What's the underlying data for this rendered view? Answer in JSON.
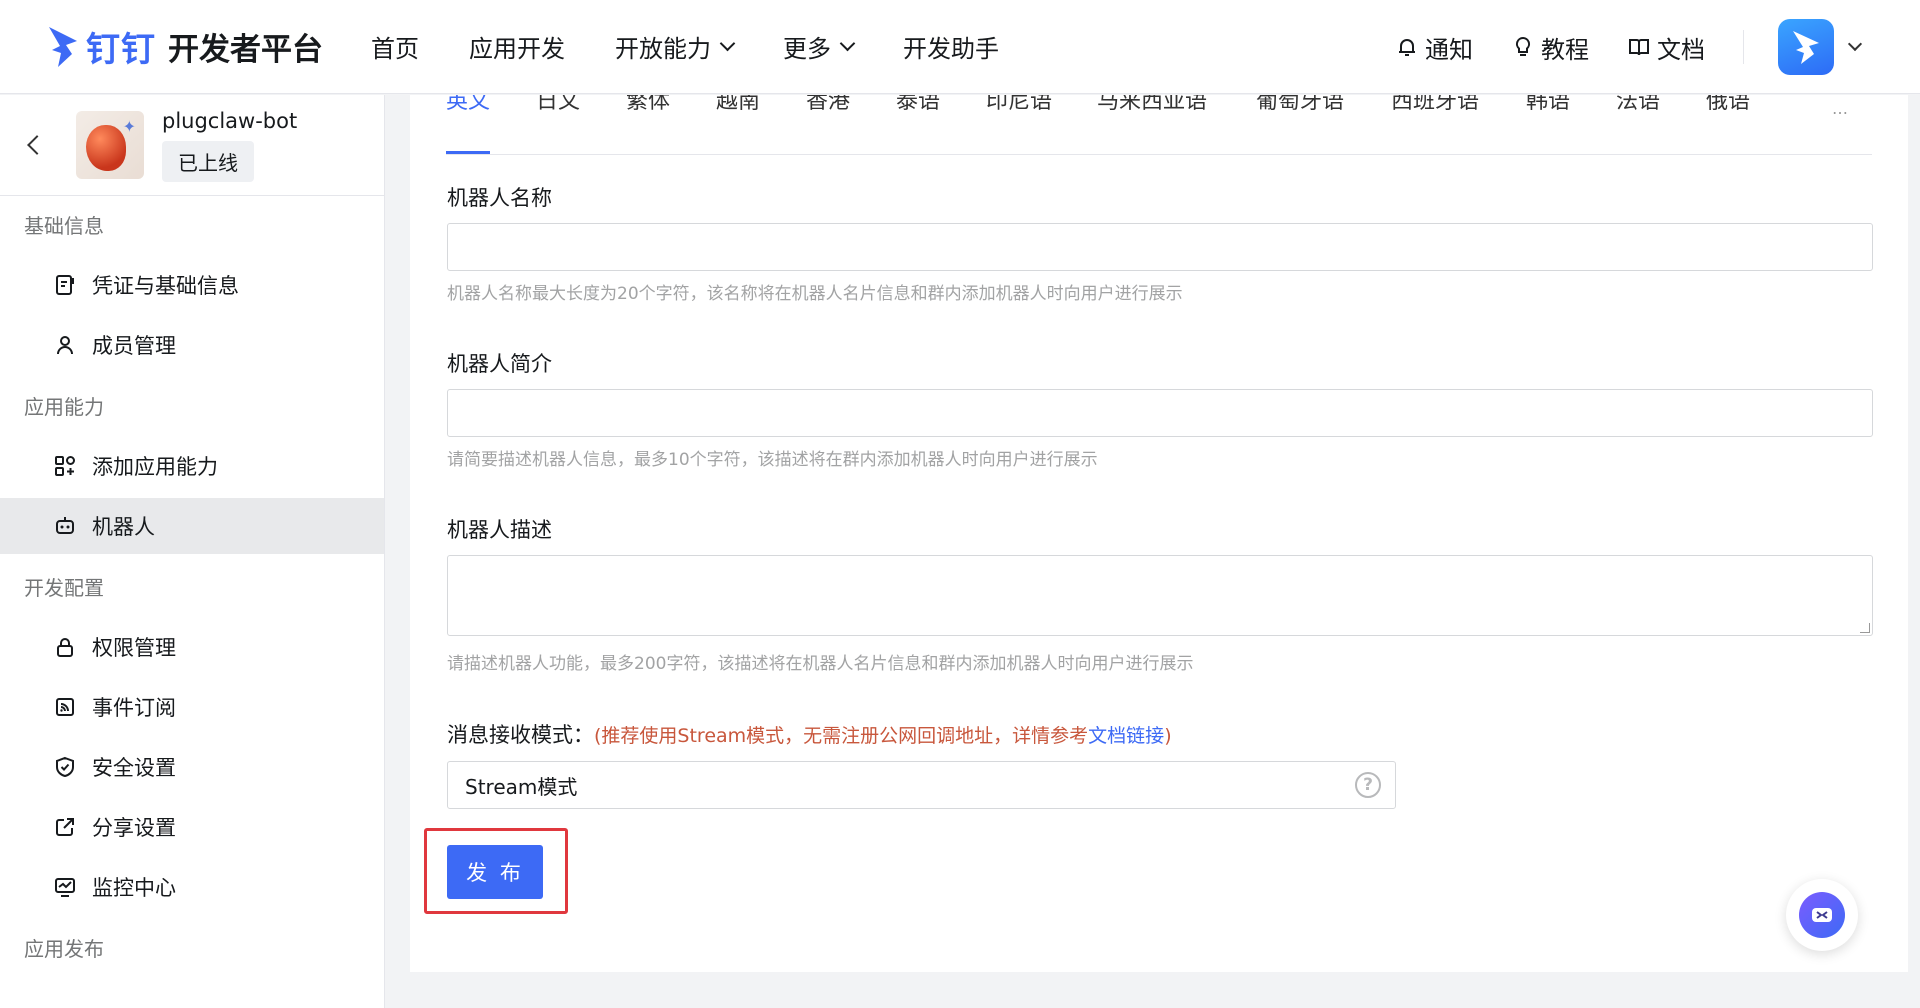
{
  "header": {
    "logo_dd": "钉钉",
    "logo_text": "开发者平台",
    "nav": [
      {
        "label": "首页"
      },
      {
        "label": "应用开发"
      },
      {
        "label": "开放能力"
      },
      {
        "label": "更多"
      },
      {
        "label": "开发助手"
      }
    ],
    "links": {
      "notify": "通知",
      "tutorial": "教程",
      "docs": "文档"
    }
  },
  "sidebar": {
    "app_name": "plugclaw-bot",
    "app_status": "已上线",
    "sections": [
      {
        "title": "基础信息",
        "items": [
          {
            "label": "凭证与基础信息",
            "icon": "credential-icon"
          },
          {
            "label": "成员管理",
            "icon": "member-icon"
          }
        ]
      },
      {
        "title": "应用能力",
        "items": [
          {
            "label": "添加应用能力",
            "icon": "apps-add-icon"
          },
          {
            "label": "机器人",
            "icon": "robot-icon",
            "active": true
          }
        ]
      },
      {
        "title": "开发配置",
        "items": [
          {
            "label": "权限管理",
            "icon": "lock-icon"
          },
          {
            "label": "事件订阅",
            "icon": "subscribe-icon"
          },
          {
            "label": "安全设置",
            "icon": "shield-icon"
          },
          {
            "label": "分享设置",
            "icon": "share-icon"
          },
          {
            "label": "监控中心",
            "icon": "monitor-icon"
          }
        ]
      },
      {
        "title": "应用发布",
        "items": []
      }
    ]
  },
  "main": {
    "lang_tabs": [
      "英文",
      "日文",
      "繁体",
      "越南",
      "香港",
      "泰语",
      "印尼语",
      "马来西亚语",
      "葡萄牙语",
      "西班牙语",
      "韩语",
      "法语",
      "俄语",
      "…"
    ],
    "active_tab": "英文",
    "fields": {
      "name_label": "机器人名称",
      "name_value": "",
      "name_hint": "机器人名称最大长度为20个字符，该名称将在机器人名片信息和群内添加机器人时向用户进行展示",
      "intro_label": "机器人简介",
      "intro_value": "",
      "intro_hint": "请简要描述机器人信息，最多10个字符，该描述将在群内添加机器人时向用户进行展示",
      "desc_label": "机器人描述",
      "desc_value": "",
      "desc_hint": "请描述机器人功能，最多200字符，该描述将在机器人名片信息和群内添加机器人时向用户进行展示"
    },
    "mode": {
      "label": "消息接收模式：",
      "note_open": "(",
      "note_text": "推荐使用Stream模式，无需注册公网回调地址，详情参考",
      "note_link": "文档链接",
      "note_close": ")",
      "value": "Stream模式"
    },
    "publish_label": "发 布"
  }
}
